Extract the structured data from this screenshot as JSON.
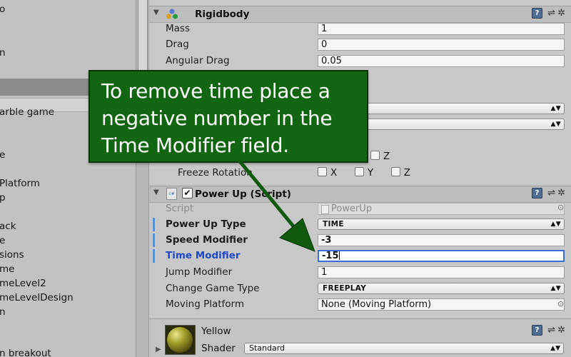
{
  "hierarchy": {
    "items": [
      "o",
      "",
      "n",
      "",
      "",
      "",
      "arble game",
      "",
      "e",
      "",
      "Platform",
      "p",
      "",
      "ack",
      "e",
      "sions",
      "me",
      "meLevel2",
      "meLevelDesign",
      "n",
      "",
      "n breakout"
    ]
  },
  "rigidbody": {
    "title": "Rigidbody",
    "fields": [
      {
        "label": "Mass",
        "value": "1"
      },
      {
        "label": "Drag",
        "value": "0"
      },
      {
        "label": "Angular Drag",
        "value": "0.05"
      }
    ],
    "freeze_rotation_label": "Freeze Rotation",
    "axis_x": "X",
    "axis_y": "Y",
    "axis_z": "Z"
  },
  "powerup": {
    "title": "Power Up (Script)",
    "script_label": "Script",
    "script_value": "PowerUp",
    "fields": [
      {
        "label": "Power Up Type",
        "value": "TIME"
      },
      {
        "label": "Speed Modifier",
        "value": "-3"
      },
      {
        "label": "Time Modifier",
        "value": "-15"
      },
      {
        "label": "Jump Modifier",
        "value": "1"
      },
      {
        "label": "Change Game Type",
        "value": "FREEPLAY"
      },
      {
        "label": "Moving Platform",
        "value": "None (Moving Platform)"
      }
    ]
  },
  "material": {
    "name": "Yellow",
    "shader_label": "Shader",
    "shader_value": "Standard"
  },
  "callout": {
    "text": "To remove time place a negative number in the Time Modifier field."
  },
  "colors": {
    "callout_bg": "#126612",
    "focus_blue": "#3a6fd8",
    "active_label": "#1d47c8"
  }
}
